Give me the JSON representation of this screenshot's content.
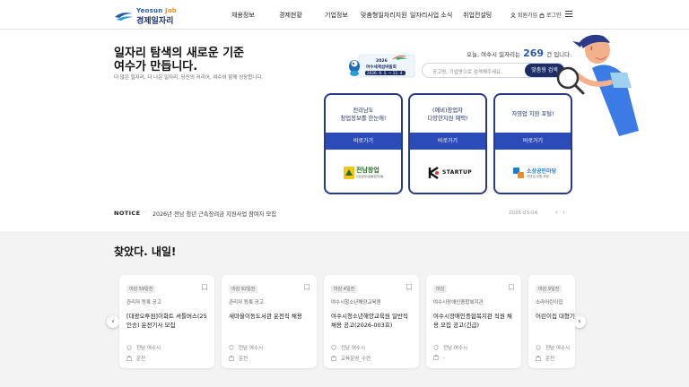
{
  "header": {
    "logo_top": "Yeosun",
    "logo_job": "Job",
    "logo_main": "경제일자리",
    "nav": [
      "채용정보",
      "경제현황",
      "기업정보",
      "맞춤형일자리지원",
      "일자리사업 소식",
      "취업컨설팅"
    ],
    "signup": "회원가입",
    "login": "로그인"
  },
  "hero": {
    "headline_1": "일자리 탐색의 새로운 기준",
    "headline_2": "여수가 만듭니다.",
    "subtitle": "더 많은 일자리, 더 나은 일자리, 당신의 커리어, 여수와 함께 성장합니다.",
    "expo_line1": "2026",
    "expo_line2": "여수세계섬박람회",
    "expo_line3": "2026. 9. 5. ~ 11. 4.",
    "count_prefix": "오늘, 여수시 일자리는",
    "count_value": "269",
    "count_suffix": "건 입니다.",
    "search_placeholder": "공고명, 기업명으로 검색해주세요.",
    "search_button": "맞춤형 검색"
  },
  "cards": [
    {
      "title_1": "전라남도",
      "title_2": "창업정보를 한눈에!",
      "button": "바로가기",
      "logo_text": "전남창업",
      "logo_sub": "전남창업지원통합플랫폼",
      "accent": "#2d6b2a"
    },
    {
      "title_1": "(예비)창업자",
      "title_2": "다양한지원 혜택!",
      "button": "바로가기",
      "logo_text": "STARTUP",
      "logo_sub": "",
      "accent": "#111111"
    },
    {
      "title_1": "자영업 지원 포털!",
      "title_2": "",
      "button": "바로가기",
      "logo_text": "소상공인마당",
      "logo_sub": "자영업 지원 포털",
      "accent": "#1e7bd6"
    }
  ],
  "notice": {
    "label": "NOTICE",
    "separator": "·",
    "text": "2026년 전남 청년 근속장려금 지원사업 참여자 모집",
    "date": "2026-03-04",
    "prev": "‹",
    "next": "›"
  },
  "section": {
    "title": "찾았다. 내일!"
  },
  "jobs": [
    {
      "badge": "마감 59일전",
      "company": "관리자 등록 공고",
      "title": "[대광오투원]이화트 셔틀버스(25인승) 운전기사 모집",
      "location": "전남 여수시",
      "job": "운전"
    },
    {
      "badge": "마감 92일전",
      "company": "관리자 등록 공고",
      "title": "새마을이동도서관 운전직 채용",
      "location": "전남 여수시",
      "job": "운전"
    },
    {
      "badge": "마감 4일전",
      "company": "여수시청소년해양교육원",
      "title": "여수시청소년해양교육원 일반직 채용 공고(2026-003호)",
      "location": "전남 여수시",
      "job": "교육운영_수련"
    },
    {
      "badge": "마감",
      "company": "여수시장애인종합복지관",
      "title": "여수시장애인종합복지관 직원 채용 모집 공고(긴급)",
      "location": "전남 여수시",
      "job": "-"
    },
    {
      "badge": "마감 9일전",
      "company": "소라어린이집",
      "title": "어린이집 대형기사",
      "location": "전남 여수시",
      "job": "운전"
    }
  ],
  "carousel": {
    "prev": "‹",
    "next": "›"
  },
  "colors": {
    "navy": "#1d2d66",
    "brand_blue": "#2b4bb8",
    "accent_orange": "#f08c1e"
  }
}
